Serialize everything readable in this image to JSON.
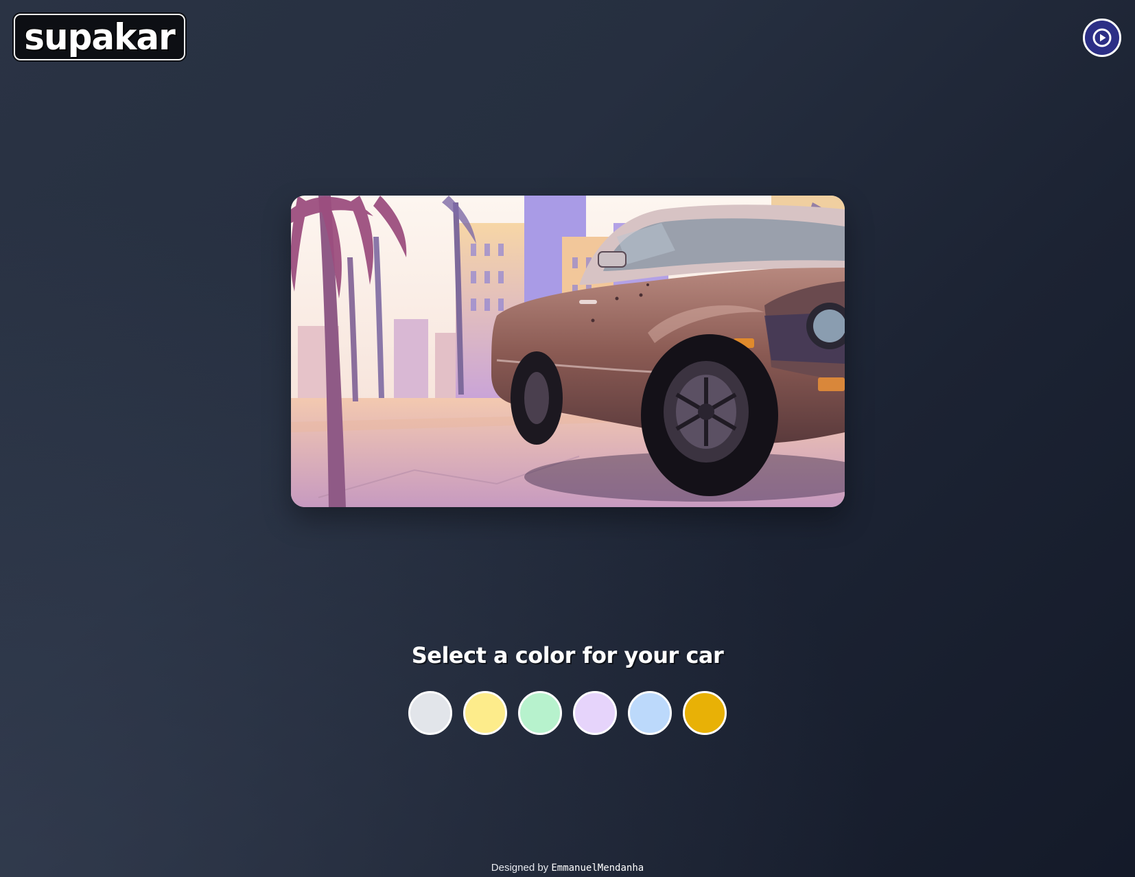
{
  "brand": {
    "logo_text": "supakar"
  },
  "header": {
    "play_icon": "play-circle-icon"
  },
  "hero": {
    "image_alt": "Illustration of a vintage car on a palm-lined street"
  },
  "color_picker": {
    "heading": "Select a color for your car",
    "colors": [
      "#e2e5ea",
      "#fdec8b",
      "#b7f2cd",
      "#e6d4fb",
      "#bcd9fb",
      "#e8b106"
    ]
  },
  "footer": {
    "prefix": "Designed by ",
    "author": "EmmanuelMendanha"
  }
}
